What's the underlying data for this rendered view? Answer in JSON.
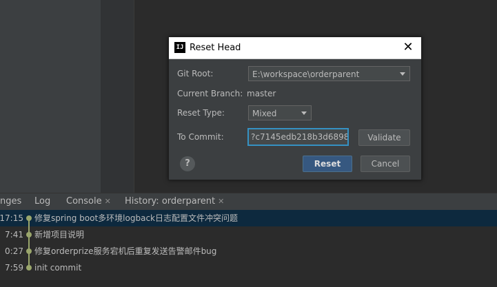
{
  "dialog": {
    "title": "Reset Head",
    "git_root_label": "Git Root:",
    "git_root_value": "E:\\workspace\\orderparent",
    "current_branch_label": "Current Branch:",
    "current_branch_value": "master",
    "reset_type_label": "Reset Type:",
    "reset_type_value": "Mixed",
    "to_commit_label": "To Commit:",
    "to_commit_value": "?c7145edb218b3d6898",
    "validate_label": "Validate",
    "reset_label": "Reset",
    "cancel_label": "Cancel",
    "help_label": "?"
  },
  "tabs": [
    {
      "label": "nges"
    },
    {
      "label": "Log"
    },
    {
      "label": "Console"
    },
    {
      "label": "History: orderparent"
    }
  ],
  "history": [
    {
      "time": "17:15",
      "message": "修复spring boot多环境logback日志配置文件冲突问题"
    },
    {
      "time": "7:41",
      "message": "新增项目说明"
    },
    {
      "time": "0:27",
      "message": "修复orderprize服务宕机后重复发送告警邮件bug"
    },
    {
      "time": "7:59",
      "message": "init commit"
    }
  ],
  "colors": {
    "graph": "#9aa66c",
    "selection": "#0d293e",
    "primary_button": "#365880"
  }
}
